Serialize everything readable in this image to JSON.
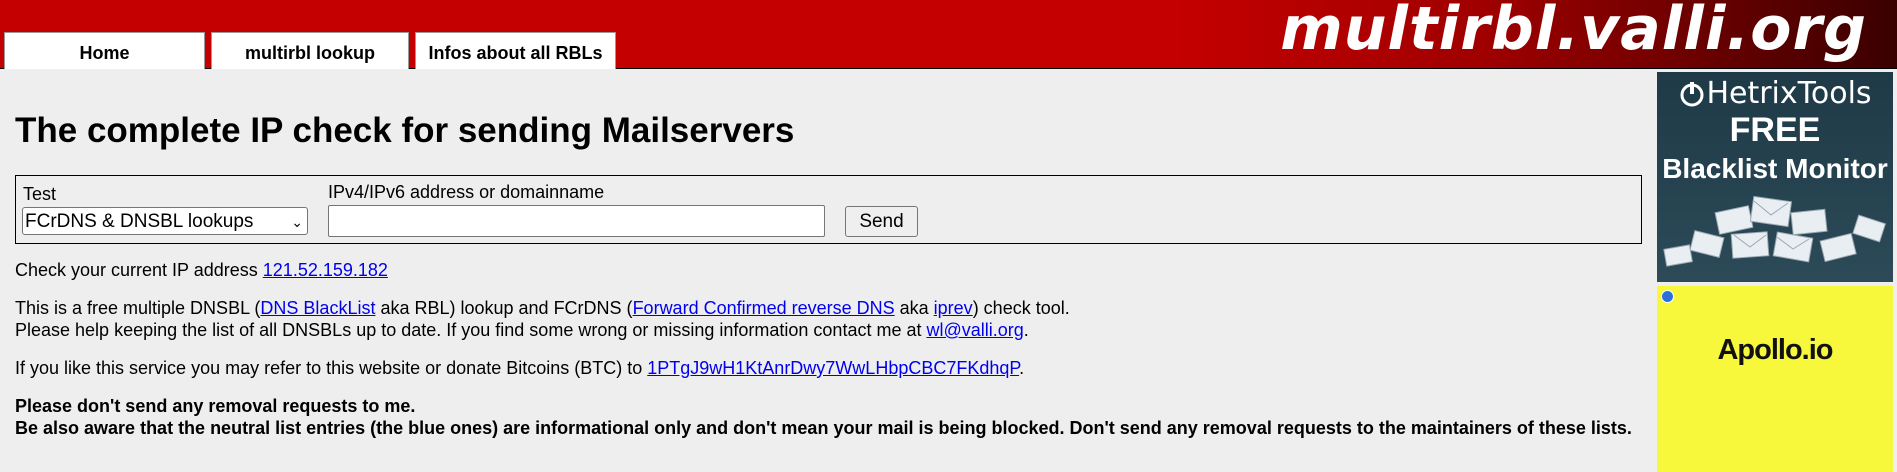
{
  "header": {
    "site_logo": "multirbl.valli.org",
    "tabs": [
      {
        "label": "Home"
      },
      {
        "label": "multirbl lookup"
      },
      {
        "label": "Infos about all RBLs"
      }
    ]
  },
  "main": {
    "title": "The complete IP check for sending Mailservers",
    "form": {
      "test_label": "Test",
      "test_selected": "FCrDNS & DNSBL lookups",
      "address_label": "IPv4/IPv6 address or domainname",
      "address_value": "",
      "send_label": "Send"
    },
    "current_ip": {
      "text": "Check your current IP address ",
      "ip": "121.52.159.182"
    },
    "info": {
      "text1": "This is a free multiple DNSBL (",
      "link1": "DNS BlackList",
      "text2": " aka RBL) lookup and FCrDNS (",
      "link2": "Forward Confirmed reverse DNS",
      "text3": " aka ",
      "link3": "iprev",
      "text4": ") check tool.",
      "text5": "Please help keeping the list of all DNSBLs up to date. If you find some wrong or missing information contact me at ",
      "email": "wl@valli.org",
      "text6": "."
    },
    "donate": {
      "text": "If you like this service you may refer to this website or donate Bitcoins (BTC) to ",
      "address": "1PTgJ9wH1KtAnrDwy7WwLHbpCBC7FKdhqP",
      "end": "."
    },
    "warning": {
      "line1": "Please don't send any removal requests to me.",
      "line2": "Be also aware that the neutral list entries (the blue ones) are informational only and don't mean your mail is being blocked. Don't send any removal requests to the maintainers of these lists."
    }
  },
  "ads": {
    "hetrix": {
      "brand": "HetrixTools",
      "line1": "FREE",
      "line2": "Blacklist Monitor"
    },
    "apollo": {
      "brand": "Apollo.io"
    }
  },
  "colors": {
    "header_red": "#c40000",
    "link_blue": "#0000ee",
    "page_bg": "#eeeeee",
    "ad_yellow": "#f7f73b",
    "ad_dark": "#1f3a47"
  }
}
